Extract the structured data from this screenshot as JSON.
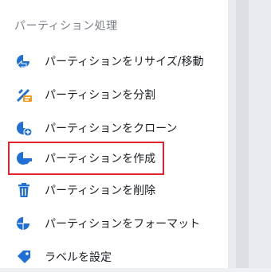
{
  "section": {
    "title": "パーティション処理"
  },
  "menu": {
    "items": [
      {
        "label": "パーティションをリサイズ/移動",
        "icon": "resize-move-icon"
      },
      {
        "label": "パーティションを分割",
        "icon": "split-icon"
      },
      {
        "label": "パーティションをクローン",
        "icon": "clone-icon"
      },
      {
        "label": "パーティションを作成",
        "icon": "create-icon",
        "selected": true
      },
      {
        "label": "パーティションを削除",
        "icon": "delete-icon"
      },
      {
        "label": "パーティションをフォーマット",
        "icon": "format-icon"
      },
      {
        "label": "ラベルを設定",
        "icon": "label-tag-icon"
      }
    ]
  },
  "colors": {
    "icon_blue": "#1f6fd6",
    "selection_border": "#e2232e",
    "badge_orange": "#f39b1b"
  }
}
